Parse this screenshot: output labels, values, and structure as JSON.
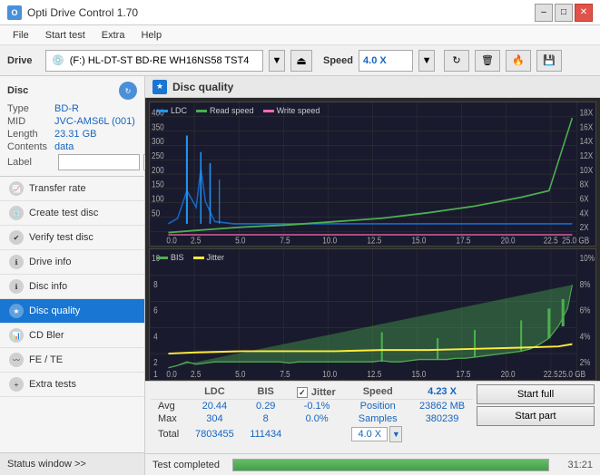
{
  "titlebar": {
    "title": "Opti Drive Control 1.70",
    "icon_text": "O",
    "minimize": "–",
    "maximize": "□",
    "close": "✕"
  },
  "menubar": {
    "items": [
      "File",
      "Start test",
      "Extra",
      "Help"
    ]
  },
  "drivebar": {
    "label": "Drive",
    "drive_value": "(F:)  HL-DT-ST BD-RE  WH16NS58 TST4",
    "speed_label": "Speed",
    "speed_value": "4.0 X"
  },
  "disc": {
    "title": "Disc",
    "type_label": "Type",
    "type_value": "BD-R",
    "mid_label": "MID",
    "mid_value": "JVC-AMS6L (001)",
    "length_label": "Length",
    "length_value": "23.31 GB",
    "contents_label": "Contents",
    "contents_value": "data",
    "label_label": "Label",
    "label_value": ""
  },
  "nav": {
    "items": [
      {
        "label": "Transfer rate",
        "active": false
      },
      {
        "label": "Create test disc",
        "active": false
      },
      {
        "label": "Verify test disc",
        "active": false
      },
      {
        "label": "Drive info",
        "active": false
      },
      {
        "label": "Disc info",
        "active": false
      },
      {
        "label": "Disc quality",
        "active": true
      },
      {
        "label": "CD Bler",
        "active": false
      },
      {
        "label": "FE / TE",
        "active": false
      },
      {
        "label": "Extra tests",
        "active": false
      }
    ]
  },
  "status_window": "Status window >>",
  "disc_quality": {
    "title": "Disc quality",
    "legend": {
      "ldc": "LDC",
      "read_speed": "Read speed",
      "write_speed": "Write speed",
      "bis": "BIS",
      "jitter": "Jitter"
    },
    "chart1": {
      "ymax": 400,
      "ylabel_right": [
        "18X",
        "16X",
        "14X",
        "12X",
        "10X",
        "8X",
        "6X",
        "4X",
        "2X"
      ],
      "xmax": 25.0,
      "x_ticks": [
        "0.0",
        "2.5",
        "5.0",
        "7.5",
        "10.0",
        "12.5",
        "15.0",
        "17.5",
        "20.0",
        "22.5",
        "25.0 GB"
      ]
    },
    "chart2": {
      "ymax": 10,
      "ylabel_right": [
        "10%",
        "8%",
        "6%",
        "4%",
        "2%"
      ],
      "x_ticks": [
        "0.0",
        "2.5",
        "5.0",
        "7.5",
        "10.0",
        "12.5",
        "15.0",
        "17.5",
        "20.0",
        "22.5",
        "25.0 GB"
      ]
    }
  },
  "stats": {
    "headers": [
      "",
      "LDC",
      "BIS",
      "",
      "Jitter",
      "Speed",
      ""
    ],
    "rows": [
      {
        "label": "Avg",
        "ldc": "20.44",
        "bis": "0.29",
        "jitter": "-0.1%"
      },
      {
        "label": "Max",
        "ldc": "304",
        "bis": "8",
        "jitter": "0.0%"
      },
      {
        "label": "Total",
        "ldc": "7803455",
        "bis": "111434",
        "jitter": ""
      }
    ],
    "jitter_checked": true,
    "speed_current": "4.23 X",
    "speed_setting": "4.0 X",
    "position_label": "Position",
    "position_value": "23862 MB",
    "samples_label": "Samples",
    "samples_value": "380239",
    "btn_start_full": "Start full",
    "btn_start_part": "Start part"
  },
  "bottom": {
    "status_text": "Test completed",
    "progress_pct": 100,
    "time_text": "31:21"
  }
}
